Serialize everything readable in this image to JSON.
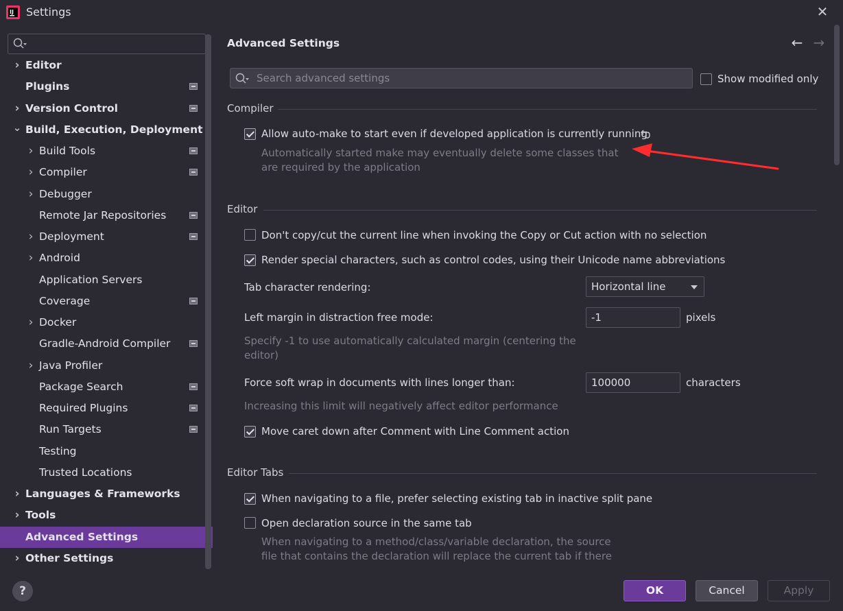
{
  "window": {
    "title": "Settings"
  },
  "sidebar": {
    "search_placeholder": "",
    "items": [
      {
        "label": "Editor",
        "level": 0,
        "bold": true,
        "expandable": true,
        "expanded": false,
        "project_icon": false
      },
      {
        "label": "Plugins",
        "level": 0,
        "bold": true,
        "expandable": false,
        "project_icon": true
      },
      {
        "label": "Version Control",
        "level": 0,
        "bold": true,
        "expandable": true,
        "expanded": false,
        "project_icon": true
      },
      {
        "label": "Build, Execution, Deployment",
        "level": 0,
        "bold": true,
        "expandable": true,
        "expanded": true,
        "project_icon": false
      },
      {
        "label": "Build Tools",
        "level": 1,
        "bold": false,
        "expandable": true,
        "expanded": false,
        "project_icon": true
      },
      {
        "label": "Compiler",
        "level": 1,
        "bold": false,
        "expandable": true,
        "expanded": false,
        "project_icon": true
      },
      {
        "label": "Debugger",
        "level": 1,
        "bold": false,
        "expandable": true,
        "expanded": false,
        "project_icon": false
      },
      {
        "label": "Remote Jar Repositories",
        "level": 1,
        "bold": false,
        "expandable": false,
        "project_icon": true
      },
      {
        "label": "Deployment",
        "level": 1,
        "bold": false,
        "expandable": true,
        "expanded": false,
        "project_icon": true
      },
      {
        "label": "Android",
        "level": 1,
        "bold": false,
        "expandable": true,
        "expanded": false,
        "project_icon": false
      },
      {
        "label": "Application Servers",
        "level": 1,
        "bold": false,
        "expandable": false,
        "project_icon": false
      },
      {
        "label": "Coverage",
        "level": 1,
        "bold": false,
        "expandable": false,
        "project_icon": true
      },
      {
        "label": "Docker",
        "level": 1,
        "bold": false,
        "expandable": true,
        "expanded": false,
        "project_icon": false
      },
      {
        "label": "Gradle-Android Compiler",
        "level": 1,
        "bold": false,
        "expandable": false,
        "project_icon": true
      },
      {
        "label": "Java Profiler",
        "level": 1,
        "bold": false,
        "expandable": true,
        "expanded": false,
        "project_icon": false
      },
      {
        "label": "Package Search",
        "level": 1,
        "bold": false,
        "expandable": false,
        "project_icon": true
      },
      {
        "label": "Required Plugins",
        "level": 1,
        "bold": false,
        "expandable": false,
        "project_icon": true
      },
      {
        "label": "Run Targets",
        "level": 1,
        "bold": false,
        "expandable": false,
        "project_icon": true
      },
      {
        "label": "Testing",
        "level": 1,
        "bold": false,
        "expandable": false,
        "project_icon": false
      },
      {
        "label": "Trusted Locations",
        "level": 1,
        "bold": false,
        "expandable": false,
        "project_icon": false
      },
      {
        "label": "Languages & Frameworks",
        "level": 0,
        "bold": true,
        "expandable": true,
        "expanded": false,
        "project_icon": false
      },
      {
        "label": "Tools",
        "level": 0,
        "bold": true,
        "expandable": true,
        "expanded": false,
        "project_icon": false
      },
      {
        "label": "Advanced Settings",
        "level": 0,
        "bold": true,
        "expandable": false,
        "project_icon": false,
        "selected": true
      },
      {
        "label": "Other Settings",
        "level": 0,
        "bold": true,
        "expandable": true,
        "expanded": false,
        "project_icon": false
      }
    ]
  },
  "main": {
    "title": "Advanced Settings",
    "search_placeholder": "Search advanced settings",
    "show_modified_label": "Show modified only",
    "show_modified_checked": false,
    "sections": {
      "compiler": {
        "name": "Compiler",
        "auto_make": {
          "label": "Allow auto-make to start even if developed application is currently running",
          "checked": true,
          "hint_line1": "Automatically started make may eventually delete some classes that",
          "hint_line2": "are required by the application"
        }
      },
      "editor": {
        "name": "Editor",
        "no_copy_line": {
          "label": "Don't copy/cut the current line when invoking the Copy or Cut action with no selection",
          "checked": false
        },
        "render_special": {
          "label": "Render special characters, such as control codes, using their Unicode name abbreviations",
          "checked": true
        },
        "tab_rendering": {
          "label": "Tab character rendering:",
          "value": "Horizontal line"
        },
        "left_margin": {
          "label": "Left margin in distraction free mode:",
          "value": "-1",
          "unit": "pixels",
          "hint_line1": "Specify -1 to use automatically calculated margin (centering the",
          "hint_line2": "editor)"
        },
        "soft_wrap": {
          "label": "Force soft wrap in documents with lines longer than:",
          "value": "100000",
          "unit": "characters",
          "hint": "Increasing this limit will negatively affect editor performance"
        },
        "move_caret": {
          "label": "Move caret down after Comment with Line Comment action",
          "checked": true
        }
      },
      "editor_tabs": {
        "name": "Editor Tabs",
        "prefer_existing": {
          "label": "When navigating to a file, prefer selecting existing tab in inactive split pane",
          "checked": true
        },
        "open_declaration": {
          "label": "Open declaration source in the same tab",
          "checked": false,
          "hint_line1": "When navigating to a method/class/variable declaration, the source",
          "hint_line2": "file that contains the declaration will replace the current tab if there"
        }
      }
    }
  },
  "footer": {
    "help_label": "?",
    "ok_label": "OK",
    "cancel_label": "Cancel",
    "apply_label": "Apply"
  },
  "colors": {
    "accent": "#6b3b9c",
    "background": "#2b2a33",
    "annotation_arrow": "#ff2d2d"
  }
}
